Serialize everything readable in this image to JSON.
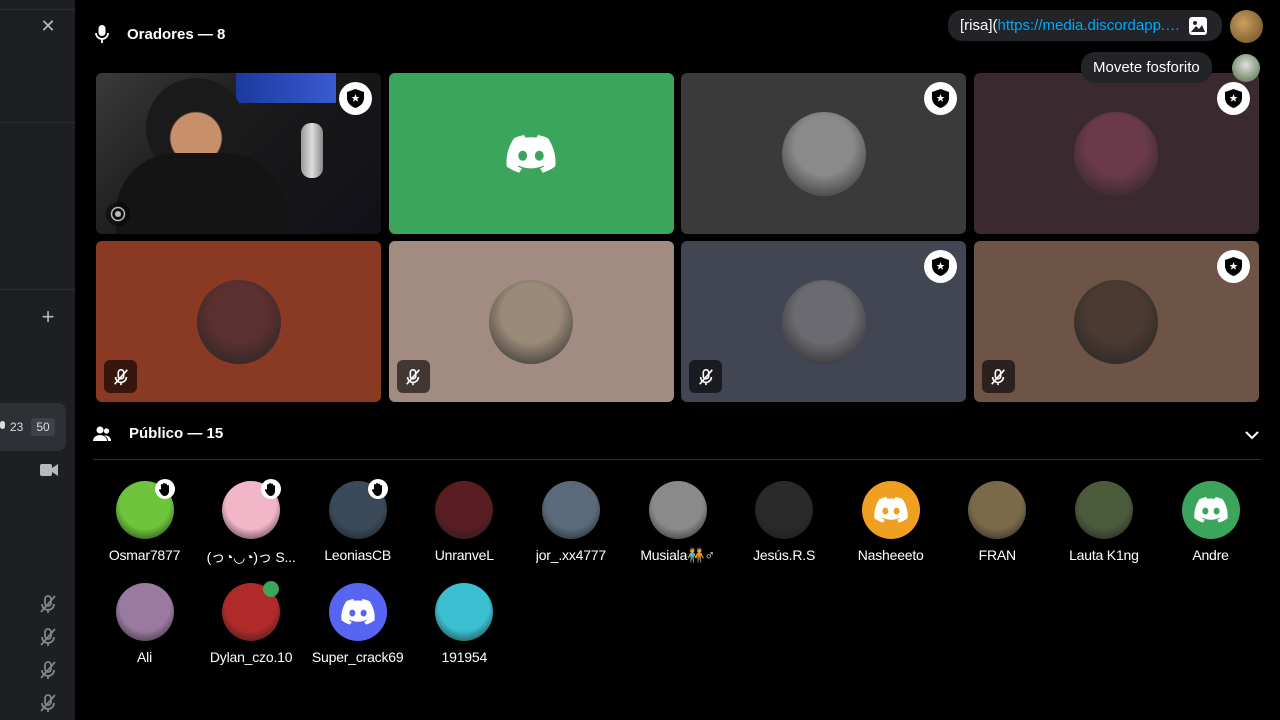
{
  "sidebar": {
    "user_count": "23",
    "user_limit": "50"
  },
  "speakers": {
    "title": "Oradores — 8",
    "tiles": [
      {
        "bg": "#2a2a2a",
        "type": "video",
        "moderator": true,
        "muted": false
      },
      {
        "bg": "#3ba55c",
        "type": "default-avatar",
        "moderator": false,
        "muted": false
      },
      {
        "bg": "#3a3a3a",
        "type": "avatar",
        "moderator": true,
        "muted": false,
        "avatar_color": "#8a8a8a"
      },
      {
        "bg": "#3a2a30",
        "type": "avatar",
        "moderator": true,
        "muted": false,
        "avatar_color": "#6b3a4a"
      },
      {
        "bg": "#8a3a22",
        "type": "avatar",
        "moderator": false,
        "muted": true,
        "avatar_color": "#5a3030"
      },
      {
        "bg": "#a28b80",
        "type": "avatar",
        "moderator": false,
        "muted": true,
        "avatar_color": "#9a8a78"
      },
      {
        "bg": "#424552",
        "type": "avatar",
        "moderator": true,
        "muted": true,
        "avatar_color": "#6a6a70"
      },
      {
        "bg": "#6e5446",
        "type": "avatar",
        "moderator": true,
        "muted": true,
        "avatar_color": "#4a3a32"
      }
    ]
  },
  "audience": {
    "title": "Público — 15",
    "members": [
      {
        "name": "Osmar7877",
        "color": "#6ec43a",
        "hand": true,
        "green_badge": false,
        "default": false
      },
      {
        "name": "(っ◔◡◔)っ S...",
        "color": "#f2b6c8",
        "hand": true,
        "green_badge": false,
        "default": false
      },
      {
        "name": "LeoniasCB",
        "color": "#3a4a5a",
        "hand": true,
        "green_badge": false,
        "default": false
      },
      {
        "name": "UnranveL",
        "color": "#5a1e22",
        "hand": false,
        "green_badge": false,
        "default": false
      },
      {
        "name": "jor_.xx4777",
        "color": "#5a6a7a",
        "hand": false,
        "green_badge": false,
        "default": false
      },
      {
        "name": "Musiala🧑‍🤝‍🧑♂",
        "color": "#8a8a8a",
        "hand": false,
        "green_badge": false,
        "default": false
      },
      {
        "name": "Jesús.R.S",
        "color": "#2a2a2a",
        "hand": false,
        "green_badge": false,
        "default": false
      },
      {
        "name": "Nasheeeto",
        "color": "#f0a020",
        "hand": false,
        "green_badge": false,
        "default": true
      },
      {
        "name": "FRAN",
        "color": "#7a6a4a",
        "hand": false,
        "green_badge": false,
        "default": false
      },
      {
        "name": "Lauta K1ng",
        "color": "#4a5a3a",
        "hand": false,
        "green_badge": false,
        "default": false
      },
      {
        "name": "Andre",
        "color": "#3ba55c",
        "hand": false,
        "green_badge": false,
        "default": true
      },
      {
        "name": "Ali",
        "color": "#9a7aa0",
        "hand": false,
        "green_badge": false,
        "default": false
      },
      {
        "name": "Dylan_czo.10",
        "color": "#b02a2a",
        "hand": false,
        "green_badge": true,
        "default": false
      },
      {
        "name": "Super_crack69",
        "color": "#5865f2",
        "hand": false,
        "green_badge": false,
        "default": true
      },
      {
        "name": "191954",
        "color": "#3ac0d0",
        "hand": false,
        "green_badge": false,
        "default": false
      }
    ]
  },
  "chat": {
    "message1_prefix": "[risa](",
    "message1_link": "https://media.discordapp.net/",
    "message2": "Movete fosforito"
  },
  "colors": {
    "accent_blue": "#00a8fc",
    "discord_green": "#3ba55c",
    "discord_blurple": "#5865f2"
  }
}
